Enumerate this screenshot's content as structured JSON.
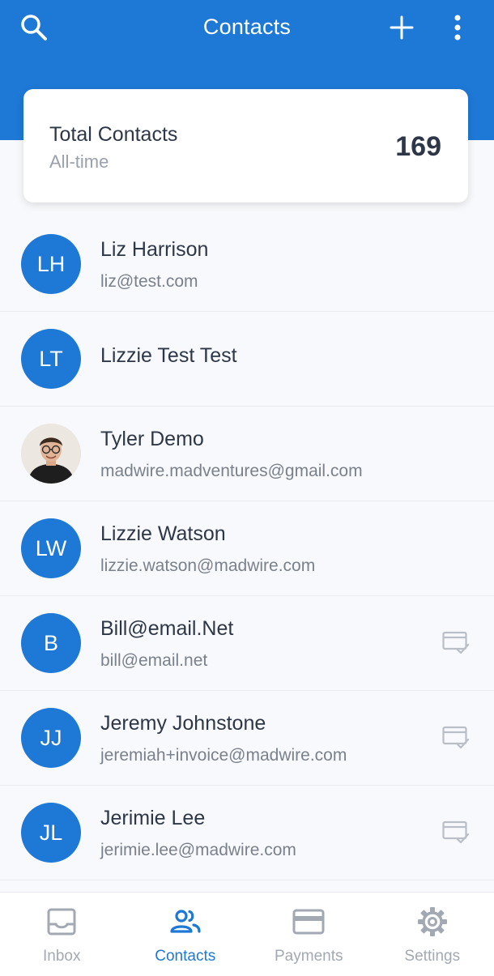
{
  "header": {
    "title": "Contacts",
    "search_icon": "search-icon",
    "add_icon": "plus-icon",
    "more_icon": "more-vertical-icon",
    "bg_color": "#1e78d6"
  },
  "summary": {
    "label": "Total Contacts",
    "period": "All-time",
    "count": "169"
  },
  "contacts": [
    {
      "initials": "LH",
      "name": "Liz Harrison",
      "email": "liz@test.com",
      "invoice": false
    },
    {
      "initials": "LT",
      "name": "Lizzie Test Test",
      "email": "",
      "invoice": false
    },
    {
      "initials": "",
      "name": "Tyler Demo",
      "email": "madwire.madventures@gmail.com",
      "invoice": false,
      "photo": true
    },
    {
      "initials": "LW",
      "name": "Lizzie Watson",
      "email": "lizzie.watson@madwire.com",
      "invoice": false
    },
    {
      "initials": "B",
      "name": "Bill@email.Net",
      "email": "bill@email.net",
      "invoice": true
    },
    {
      "initials": "JJ",
      "name": "Jeremy Johnstone",
      "email": "jeremiah+invoice@madwire.com",
      "invoice": true
    },
    {
      "initials": "JL",
      "name": "Jerimie Lee",
      "email": "jerimie.lee@madwire.com",
      "invoice": true
    }
  ],
  "tabs": [
    {
      "label": "Inbox",
      "icon": "inbox-icon",
      "active": false
    },
    {
      "label": "Contacts",
      "icon": "contacts-icon",
      "active": true
    },
    {
      "label": "Payments",
      "icon": "credit-card-icon",
      "active": false
    },
    {
      "label": "Settings",
      "icon": "gear-icon",
      "active": false
    }
  ],
  "colors": {
    "accent": "#1e78d6",
    "text_primary": "#2d3748",
    "text_secondary": "#7a818c",
    "tab_inactive": "#a3a9b3"
  }
}
